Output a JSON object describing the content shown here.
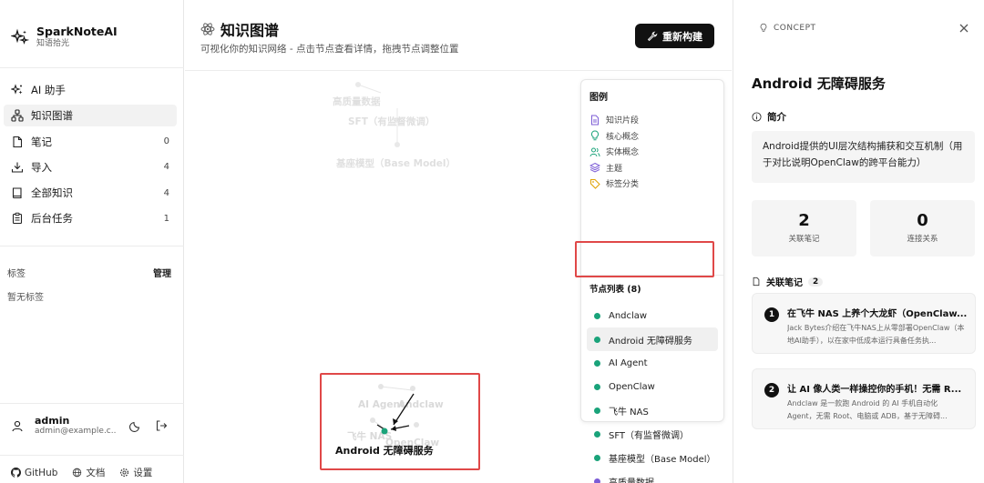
{
  "brand": {
    "name": "SparkNoteAI",
    "subtitle": "知语拾光"
  },
  "nav": [
    {
      "label": "AI 助手",
      "count": "",
      "icon": "sparkles-icon"
    },
    {
      "label": "知识图谱",
      "count": "",
      "icon": "network-icon",
      "active": true
    },
    {
      "label": "笔记",
      "count": "0",
      "icon": "note-icon"
    },
    {
      "label": "导入",
      "count": "4",
      "icon": "download-icon"
    },
    {
      "label": "全部知识",
      "count": "4",
      "icon": "book-icon"
    },
    {
      "label": "后台任务",
      "count": "1",
      "icon": "clipboard-icon"
    }
  ],
  "tags": {
    "label": "标签",
    "manage": "管理",
    "empty": "暂无标签"
  },
  "user": {
    "name": "admin",
    "email": "admin@example.c..."
  },
  "footer": {
    "github": "GitHub",
    "docs": "文档",
    "settings": "设置"
  },
  "header": {
    "title": "知识图谱",
    "subtitle": "可视化你的知识网络 - 点击节点查看详情，拖拽节点调整位置",
    "rebuild": "重新构建"
  },
  "graph": {
    "faded_labels": {
      "hq": "高质量数据",
      "sft": "SFT（有监督微调）",
      "base": "基座模型（Base Model）",
      "agent": "AI Agent",
      "andclaw": "Andclaw",
      "nas": "飞牛 NAS",
      "openclaw": "OpenClaw"
    },
    "selected_label": "Android 无障碍服务"
  },
  "legend": {
    "title": "图例",
    "types": [
      {
        "label": "知识片段",
        "icon": "document-icon",
        "color": "#7c5cd6"
      },
      {
        "label": "核心概念",
        "icon": "bulb-icon",
        "color": "#1aa37a"
      },
      {
        "label": "实体概念",
        "icon": "users-icon",
        "color": "#1aa37a"
      },
      {
        "label": "主题",
        "icon": "layers-icon",
        "color": "#7c5cd6"
      },
      {
        "label": "标签分类",
        "icon": "tag-icon",
        "color": "#e0a100"
      }
    ],
    "nodes_title": "节点列表 (8)",
    "nodes": [
      {
        "label": "Andclaw",
        "color": "#1aa37a"
      },
      {
        "label": "Android 无障碍服务",
        "color": "#1aa37a",
        "selected": true
      },
      {
        "label": "AI Agent",
        "color": "#1aa37a"
      },
      {
        "label": "OpenClaw",
        "color": "#1aa37a"
      },
      {
        "label": "飞牛 NAS",
        "color": "#1aa37a"
      },
      {
        "label": "SFT（有监督微调）",
        "color": "#1aa37a"
      },
      {
        "label": "基座模型（Base Model）",
        "color": "#1aa37a"
      },
      {
        "label": "高质量数据",
        "color": "#7c5cd6"
      }
    ]
  },
  "panel": {
    "tag": "CONCEPT",
    "title": "Android 无障碍服务",
    "intro_label": "简介",
    "intro_text": "Android提供的UI层次结构捕获和交互机制（用于对比说明OpenClaw的跨平台能力）",
    "stats": [
      {
        "value": "2",
        "label": "关联笔记"
      },
      {
        "value": "0",
        "label": "连接关系"
      }
    ],
    "notes_label": "关联笔记",
    "notes_count": "2",
    "notes": [
      {
        "no": "1",
        "title": "在飞牛 NAS 上养个大龙虾（OpenClaw...",
        "desc": "Jack Bytes介绍在飞牛NAS上从零部署OpenClaw（本地AI助手），以在家中低成本运行具备任务执..."
      },
      {
        "no": "2",
        "title": "让 AI 像人类一样操控你的手机！无需 R...",
        "desc": "Andclaw 是一款跑 Android 的 AI 手机自动化 Agent，无需 Root、电脑或 ADB，基于无障碍..."
      }
    ]
  }
}
